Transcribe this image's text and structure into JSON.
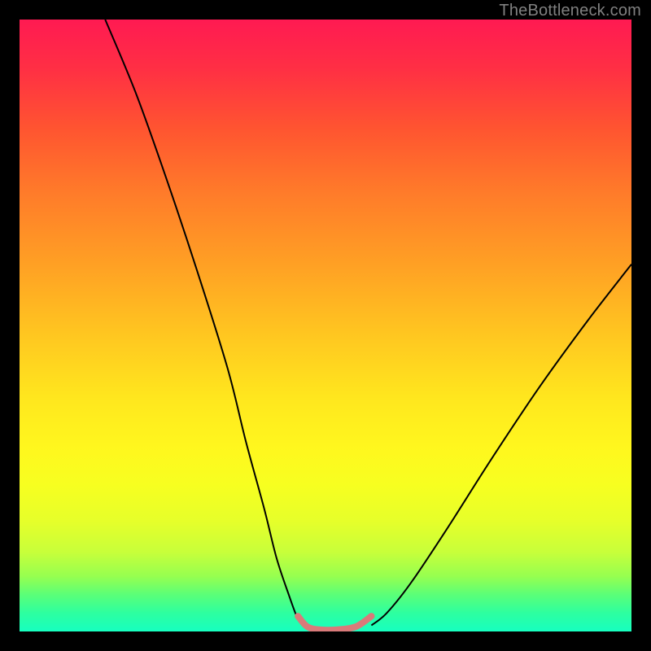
{
  "watermark": "TheBottleneck.com",
  "chart_data": {
    "type": "line",
    "title": "",
    "xlabel": "",
    "ylabel": "",
    "xlim": [
      0,
      100
    ],
    "ylim": [
      0,
      100
    ],
    "grid": false,
    "background_gradient": {
      "direction": "vertical",
      "stops": [
        {
          "pos": 0,
          "color": "#ff1a52"
        },
        {
          "pos": 50,
          "color": "#ffc020"
        },
        {
          "pos": 70,
          "color": "#fff71e"
        },
        {
          "pos": 100,
          "color": "#17ffc0"
        }
      ]
    },
    "series": [
      {
        "name": "left-curve",
        "stroke": "#000000",
        "stroke_width": 2,
        "x": [
          14,
          19,
          24,
          29,
          34,
          37,
          40,
          42,
          44,
          45.5,
          46.5
        ],
        "values": [
          100,
          88,
          74,
          59,
          43,
          31,
          20,
          12,
          6,
          2,
          1
        ]
      },
      {
        "name": "right-curve",
        "stroke": "#000000",
        "stroke_width": 2,
        "x": [
          57.5,
          60,
          64,
          70,
          77,
          85,
          93,
          100
        ],
        "values": [
          1,
          3,
          8,
          17,
          28,
          40,
          51,
          60
        ]
      },
      {
        "name": "trough-segment",
        "stroke": "#d97a7a",
        "stroke_width": 8,
        "linecap": "round",
        "x": [
          45.5,
          47,
          49,
          52,
          55,
          57.5
        ],
        "values": [
          2.5,
          0.8,
          0.3,
          0.3,
          0.8,
          2.5
        ]
      }
    ],
    "markers": [
      {
        "x": 45.5,
        "y": 2.5,
        "shape": "circle",
        "size": 8,
        "color": "#d97a7a"
      },
      {
        "x": 57.5,
        "y": 2.5,
        "shape": "circle",
        "size": 8,
        "color": "#d97a7a"
      }
    ]
  }
}
